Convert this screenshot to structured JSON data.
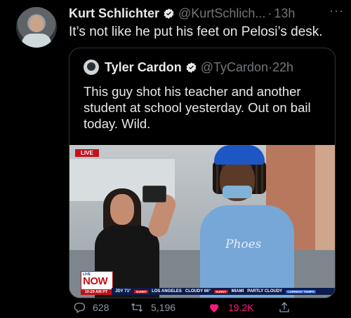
{
  "tweet": {
    "author_name": "Kurt Schlichter",
    "author_handle": "@KurtSchlich...",
    "separator": "·",
    "time": "13h",
    "more": "···",
    "text": "It’s not like he put his feet on Pelosi’s desk."
  },
  "quoted_tweet": {
    "author_name": "Tyler Cardon",
    "author_handle": "@TyCardon",
    "separator": "·",
    "time": "22h",
    "text": "This guy shot his teacher and another student at school yesterday. Out on bail today. Wild."
  },
  "video": {
    "live_tag": "LIVE",
    "now_live": "LIVE",
    "now_label": "NOW",
    "clock": "10:29 AM PT",
    "shirt_text": "Phoes",
    "ticker": [
      "JDY 71°",
      "SUNNY",
      "LOS ANGELES",
      "CLOUDY 66°",
      "SUNNY",
      "MIAMI",
      "PARTLY CLOUDY",
      "CURRENT TEMPS"
    ]
  },
  "actions": {
    "replies": "628",
    "retweets": "5,196",
    "likes": "19.2K"
  },
  "colors": {
    "background": "#000000",
    "text": "#e7e9ea",
    "muted": "#71767b",
    "verified": "#1d9bf0",
    "like": "#f91880"
  },
  "icons": [
    "verified-badge-icon",
    "reply-icon",
    "retweet-icon",
    "heart-icon",
    "share-icon"
  ]
}
